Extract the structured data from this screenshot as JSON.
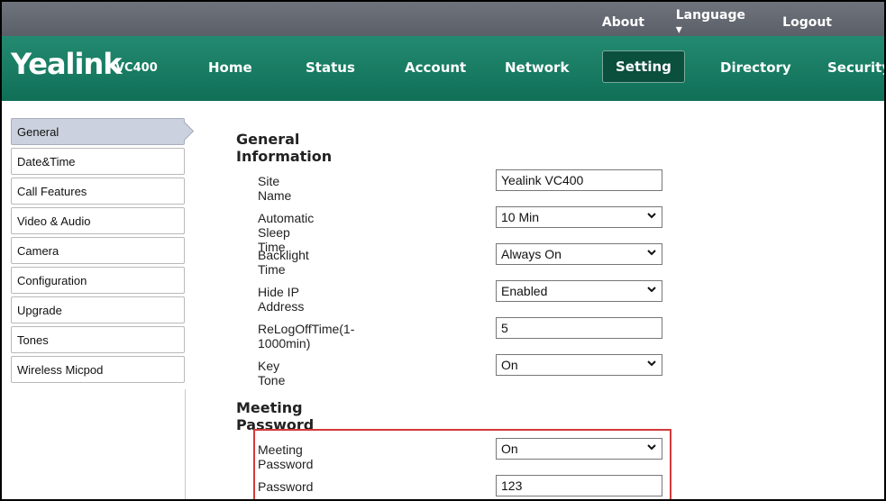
{
  "top_links": {
    "about": "About",
    "language": "Language ▾",
    "logout": "Logout"
  },
  "brand": {
    "logo": "Yealink",
    "model": "VC400"
  },
  "nav": {
    "items": [
      "Home",
      "Status",
      "Account",
      "Network",
      "Setting",
      "Directory",
      "Security"
    ],
    "active": "Setting"
  },
  "sidebar": {
    "items": [
      "General",
      "Date&Time",
      "Call Features",
      "Video & Audio",
      "Camera",
      "Configuration",
      "Upgrade",
      "Tones",
      "Wireless Micpod"
    ],
    "active": "General"
  },
  "sections": {
    "general": "General Information",
    "meeting": "Meeting Password"
  },
  "fields": {
    "site_name": {
      "label": "Site Name",
      "value": "Yealink VC400"
    },
    "sleep_time": {
      "label": "Automatic Sleep Time",
      "value": "10 Min"
    },
    "backlight": {
      "label": "Backlight Time",
      "value": "Always On"
    },
    "hide_ip": {
      "label": "Hide IP Address",
      "value": "Enabled"
    },
    "relogoff": {
      "label": "ReLogOffTime(1-1000min)",
      "value": "5"
    },
    "key_tone": {
      "label": "Key Tone",
      "value": "On"
    },
    "meeting_password": {
      "label": "Meeting Password",
      "value": "On"
    },
    "password": {
      "label": "Password",
      "value": "123"
    }
  },
  "colors": {
    "nav": "#0f6f57",
    "topbar": "#5b5f67",
    "highlight": "#d43a3a",
    "sidebar_active": "#cbd1de"
  }
}
